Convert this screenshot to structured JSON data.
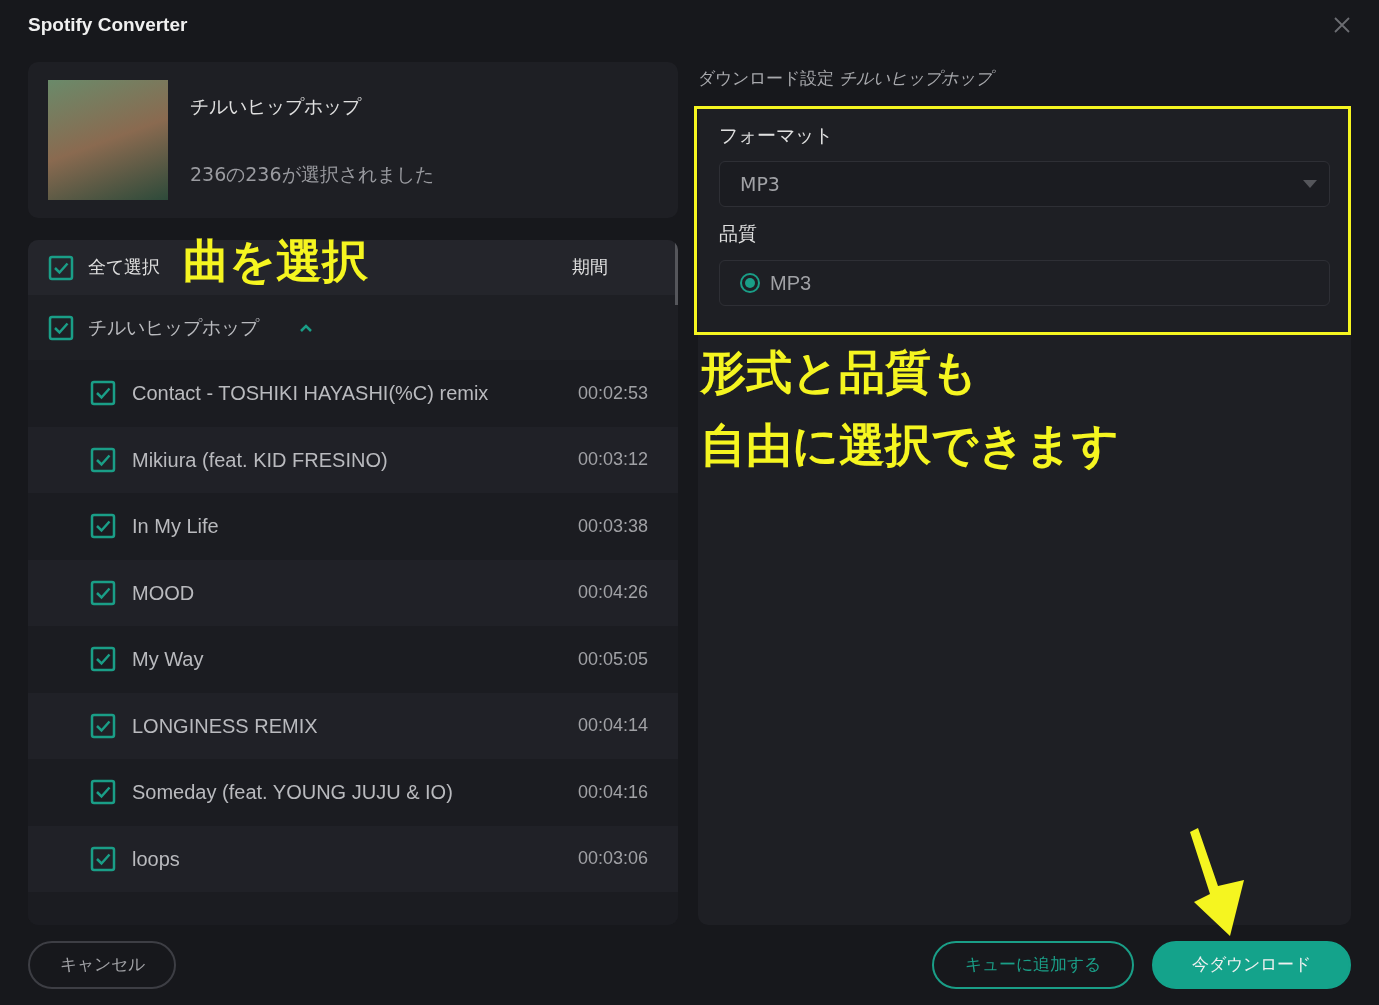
{
  "window": {
    "title": "Spotify Converter"
  },
  "album": {
    "title": "チルいヒップホップ",
    "selection": "236の236が選択されました"
  },
  "list": {
    "select_all": {
      "label": "全て選択",
      "checked": true
    },
    "duration_header": "期間",
    "playlist": {
      "title": "チルいヒップホップ",
      "checked": true,
      "expanded": true
    },
    "tracks": [
      {
        "title": "Contact - TOSHIKI HAYASHI(%C) remix",
        "duration": "00:02:53",
        "checked": true
      },
      {
        "title": "Mikiura (feat. KID FRESINO)",
        "duration": "00:03:12",
        "checked": true
      },
      {
        "title": "In My Life",
        "duration": "00:03:38",
        "checked": true
      },
      {
        "title": "MOOD",
        "duration": "00:04:26",
        "checked": true
      },
      {
        "title": "My Way",
        "duration": "00:05:05",
        "checked": true
      },
      {
        "title": "LONGINESS REMIX",
        "duration": "00:04:14",
        "checked": true
      },
      {
        "title": "Someday (feat. YOUNG JUJU & IO)",
        "duration": "00:04:16",
        "checked": true
      },
      {
        "title": "loops",
        "duration": "00:03:06",
        "checked": true
      }
    ]
  },
  "settings": {
    "heading": "ダウンロード設定 *チルいヒップホップ*",
    "format": {
      "label": "フォーマット",
      "value": "MP3"
    },
    "quality": {
      "label": "品質",
      "options": [
        {
          "label": "MP3",
          "selected": true
        }
      ]
    }
  },
  "buttons": [
    {
      "kind": "outline",
      "label": "キャンセル"
    },
    {
      "kind": "accent-outline",
      "label": "キューに追加する"
    },
    {
      "kind": "primary",
      "label": "今ダウンロード"
    }
  ],
  "annotations": [
    "曲を選択",
    "形式と品質も",
    "自由に選択できます"
  ]
}
